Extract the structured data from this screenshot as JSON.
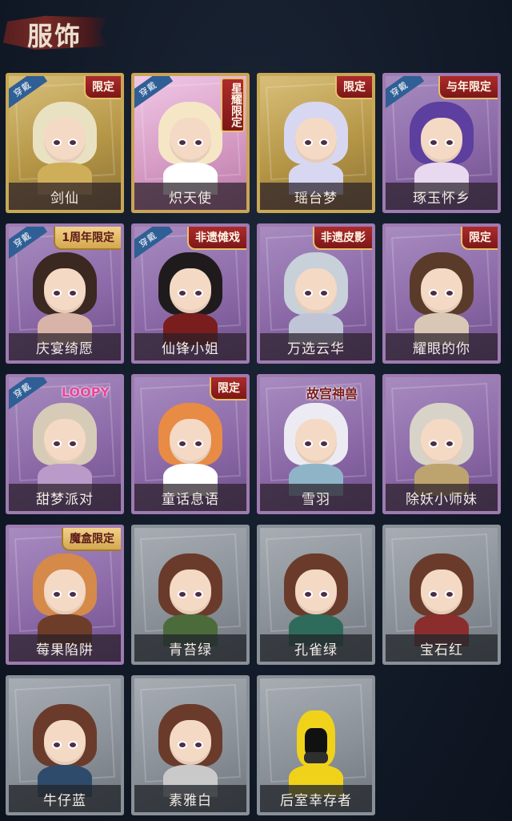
{
  "title": "服饰",
  "labels": {
    "wearing": "穿戴"
  },
  "cards": [
    {
      "name": "剑仙",
      "frame": "gold",
      "wearing": true,
      "tag": "限定",
      "tag_style": "red",
      "hair": "#e9e2c2",
      "body": "#cfae59"
    },
    {
      "name": "炽天使",
      "frame": "pink",
      "wearing": true,
      "tag": "星耀限定",
      "tag_style": "red-vertical",
      "hair": "#f5e7c6",
      "body": "#ffffff"
    },
    {
      "name": "瑶台梦",
      "frame": "gold",
      "wearing": false,
      "tag": "限定",
      "tag_style": "red",
      "hair": "#d8d7f2",
      "body": "#d8d7f2"
    },
    {
      "name": "琢玉怀乡",
      "frame": "purple",
      "wearing": true,
      "tag": "与年限定",
      "tag_style": "red",
      "hair": "#5d3f9f",
      "body": "#e8d9f0"
    },
    {
      "name": "庆宴绮愿",
      "frame": "purple",
      "wearing": true,
      "tag": "1周年限定",
      "tag_style": "yellow",
      "hair": "#3b2821",
      "body": "#d8b3a8"
    },
    {
      "name": "仙锋小姐",
      "frame": "purple",
      "wearing": true,
      "tag": "非遗傩戏",
      "tag_style": "red",
      "hair": "#1f1b1d",
      "body": "#7a1d1d"
    },
    {
      "name": "万选云华",
      "frame": "purple",
      "wearing": false,
      "tag": "非遗皮影",
      "tag_style": "red",
      "hair": "#c8d0da",
      "body": "#bfc5d6"
    },
    {
      "name": "耀眼的你",
      "frame": "purple",
      "wearing": false,
      "tag": "限定",
      "tag_style": "red",
      "hair": "#5a3b2a",
      "body": "#d9c7b5"
    },
    {
      "name": "甜梦派对",
      "frame": "purple",
      "wearing": true,
      "tag": "LOOPY",
      "tag_style": "loopy",
      "hair": "#d6cbb6",
      "body": "#b99ac8"
    },
    {
      "name": "童话息语",
      "frame": "purple",
      "wearing": false,
      "tag": "限定",
      "tag_style": "red",
      "hair": "#e88b45",
      "body": "#ffffff"
    },
    {
      "name": "雪羽",
      "frame": "purple",
      "wearing": false,
      "tag": "故宫神兽",
      "tag_style": "gugong",
      "hair": "#ecebf3",
      "body": "#8fb4c8"
    },
    {
      "name": "除妖小师妹",
      "frame": "purple",
      "wearing": false,
      "tag": "",
      "tag_style": "",
      "hair": "#d7d3c8",
      "body": "#bda46f"
    },
    {
      "name": "莓果陷阱",
      "frame": "purple",
      "wearing": false,
      "tag": "魔盒限定",
      "tag_style": "yellow",
      "hair": "#d58a4a",
      "body": "#6d3d2a"
    },
    {
      "name": "青苔绿",
      "frame": "gray",
      "wearing": false,
      "tag": "",
      "tag_style": "",
      "hair": "#6a3b2b",
      "body": "#4c6b3b"
    },
    {
      "name": "孔雀绿",
      "frame": "gray",
      "wearing": false,
      "tag": "",
      "tag_style": "",
      "hair": "#6a3b2b",
      "body": "#2f6b5a"
    },
    {
      "name": "宝石红",
      "frame": "gray",
      "wearing": false,
      "tag": "",
      "tag_style": "",
      "hair": "#6a3b2b",
      "body": "#8b2d2d"
    },
    {
      "name": "牛仔蓝",
      "frame": "gray",
      "wearing": false,
      "tag": "",
      "tag_style": "",
      "hair": "#6a3b2b",
      "body": "#2f4b6b"
    },
    {
      "name": "素雅白",
      "frame": "gray",
      "wearing": false,
      "tag": "",
      "tag_style": "",
      "hair": "#6a3b2b",
      "body": "#c9c9c9"
    },
    {
      "name": "后室幸存者",
      "frame": "gray",
      "wearing": false,
      "tag": "",
      "tag_style": "",
      "special": "hazmat",
      "hair": "#f1d21a",
      "body": "#f1d21a"
    }
  ]
}
